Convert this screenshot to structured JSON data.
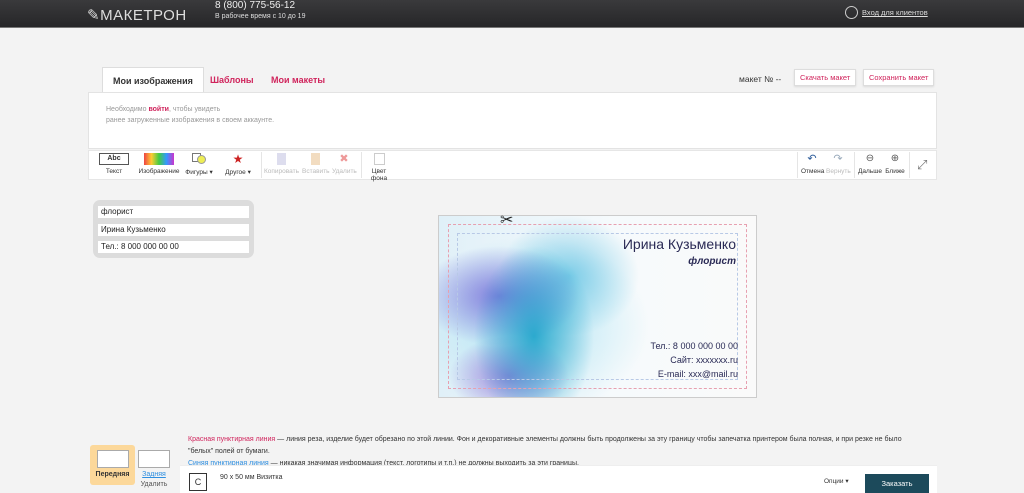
{
  "header": {
    "logo": "МАКЕТРОН",
    "phone": "8 (800) 775-56-12",
    "hours": "В рабочее время с 10 до 19",
    "login": "Вход для клиентов"
  },
  "tabs": [
    {
      "label": "Мои изображения"
    },
    {
      "label": "Шаблоны"
    },
    {
      "label": "Мои макеты"
    }
  ],
  "maket_no": "макет № --",
  "buttons": {
    "download": "Скачать макет",
    "save": "Сохранить макет"
  },
  "note": {
    "pre": "Необходимо ",
    "link": "войти",
    "post": ", чтобы увидеть",
    "line2": "ранее загруженные изображения в своем аккаунте."
  },
  "toolbar": {
    "text": "Текст",
    "abc": "Abc",
    "image": "Изображение",
    "shapes": "Фигуры",
    "other": "Другое",
    "copy": "Копировать",
    "paste": "Вставить",
    "delete": "Удалить",
    "bgcolor": "Цвет фона",
    "undo": "Отмена",
    "redo": "Вернуть",
    "zoom_out": "Дальше",
    "zoom_in": "Ближе"
  },
  "fields": [
    "флорист",
    "Ирина Кузьменко",
    "Тел.: 8 000 000 00 00"
  ],
  "card": {
    "name": "Ирина Кузьменко",
    "title": "флорист",
    "phone": "Тел.: 8 000 000 00 00",
    "site": "Сайт: xxxxxxx.ru",
    "email": "E-mail: xxx@mail.ru"
  },
  "info": {
    "red_label": "Красная пунктирная линия",
    "red_text": " — линия реза, изделие будет обрезано по этой линии. Фон и декоративные элементы должны быть продолжены за эту границу чтобы запечатка принтером была полная, и при резке не было \"белых\" полей от бумаги.",
    "blue_label": "Синяя пунктирная линия",
    "blue_text": " — никакая значимая информация (текст, логотипы и т.п.) не должны выходить за эти границы."
  },
  "sides": {
    "front": "Передняя",
    "back": "Задняя",
    "remove": "Удалить"
  },
  "product": {
    "icon_letter": "C",
    "name": "90 x 50 мм Визитка",
    "options": "Опции",
    "order": "Заказать"
  }
}
